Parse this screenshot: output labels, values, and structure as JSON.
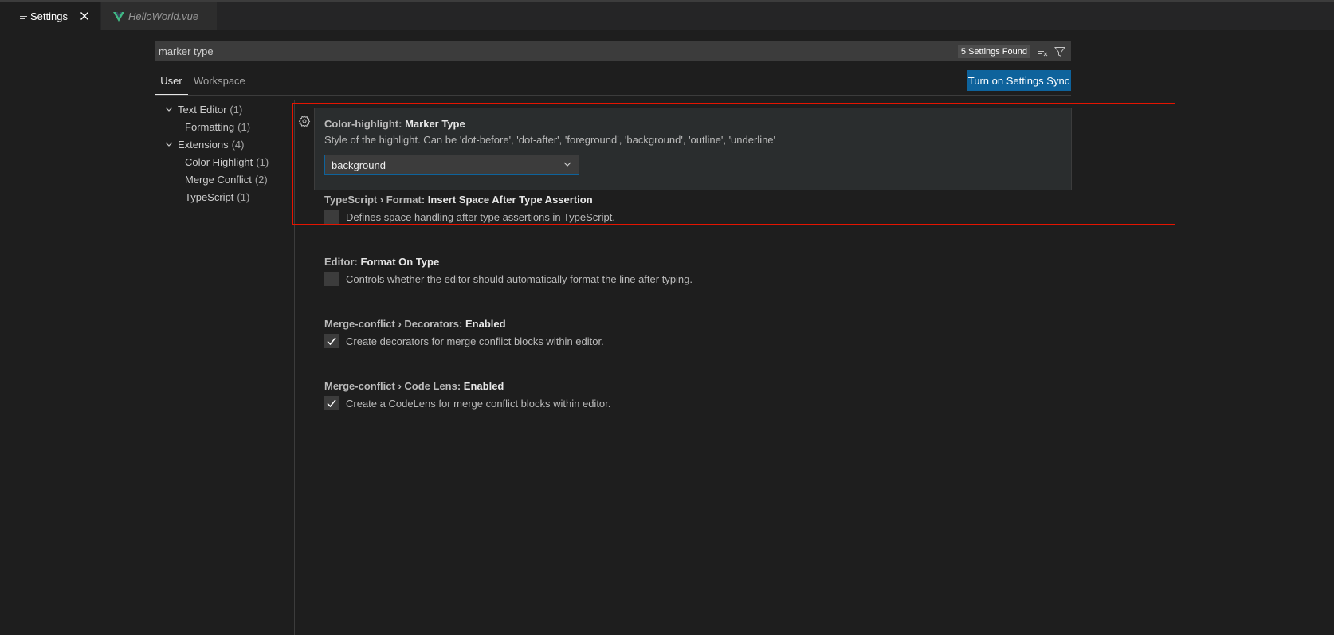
{
  "tabs": [
    {
      "label": "Settings",
      "icon": "settings-editor-icon"
    },
    {
      "label": "HelloWorld.vue",
      "icon": "vue-file-icon"
    }
  ],
  "search": {
    "value": "marker type",
    "count_label": "5 Settings Found",
    "clear_icon": "clear-filter-icon",
    "filter_icon": "filter-icon"
  },
  "scope_tabs": {
    "user": "User",
    "workspace": "Workspace"
  },
  "sync_button": "Turn on Settings Sync",
  "toc": {
    "text_editor": {
      "label": "Text Editor",
      "count": "(1)"
    },
    "formatting": {
      "label": "Formatting",
      "count": "(1)"
    },
    "extensions": {
      "label": "Extensions",
      "count": "(4)"
    },
    "color_highlight": {
      "label": "Color Highlight",
      "count": "(1)"
    },
    "merge_conflict": {
      "label": "Merge Conflict",
      "count": "(2)"
    },
    "typescript": {
      "label": "TypeScript",
      "count": "(1)"
    }
  },
  "settings": [
    {
      "category": "Color-highlight: ",
      "name": "Marker Type",
      "description": "Style of the highlight. Can be 'dot-before', 'dot-after', 'foreground', 'background', 'outline', 'underline'",
      "control": "select",
      "value": "background"
    },
    {
      "category": "TypeScript › Format: ",
      "name": "Insert Space After Type Assertion",
      "description": "Defines space handling after type assertions in TypeScript.",
      "control": "checkbox",
      "checked": false
    },
    {
      "category": "Editor: ",
      "name": "Format On Type",
      "description": "Controls whether the editor should automatically format the line after typing.",
      "control": "checkbox",
      "checked": false
    },
    {
      "category": "Merge-conflict › Decorators: ",
      "name": "Enabled",
      "description": "Create decorators for merge conflict blocks within editor.",
      "control": "checkbox",
      "checked": true
    },
    {
      "category": "Merge-conflict › Code Lens: ",
      "name": "Enabled",
      "description": "Create a CodeLens for merge conflict blocks within editor.",
      "control": "checkbox",
      "checked": true
    }
  ],
  "colors": {
    "background": "#1e1e1e",
    "accent": "#0e639c",
    "highlight_border": "#e51400",
    "vue_green": "#41b883"
  }
}
